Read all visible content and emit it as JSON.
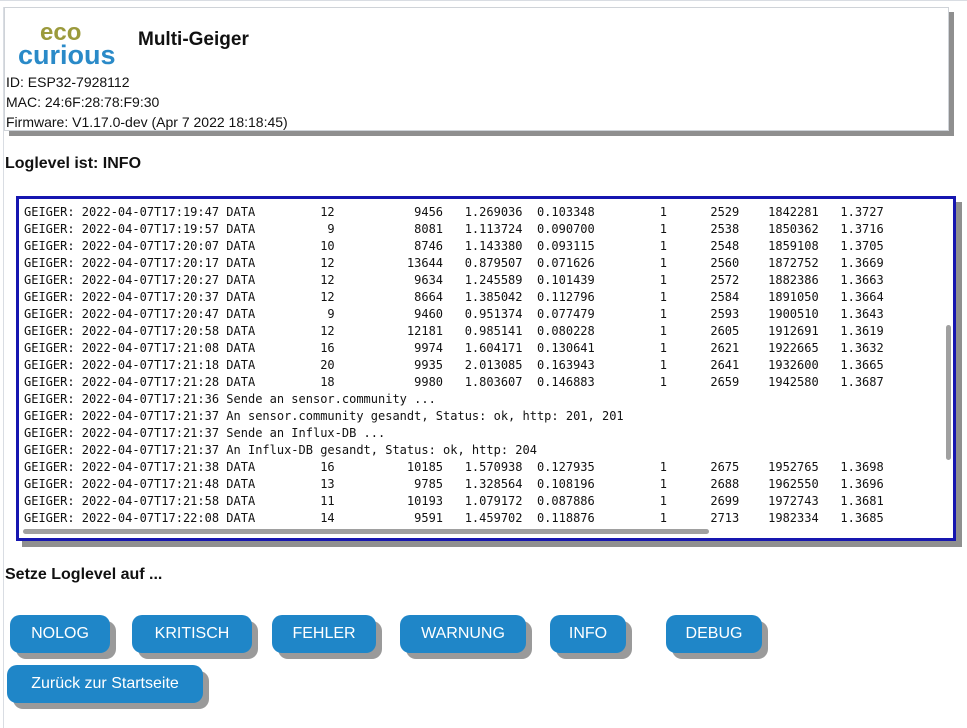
{
  "header": {
    "logo_top": "eco",
    "logo_bottom": "curious",
    "title": "Multi-Geiger",
    "id_line": "ID: ESP32-7928112",
    "mac_line": "MAC: 24:6F:28:78:F9:30",
    "firmware_line": "Firmware: V1.17.0-dev (Apr 7 2022 18:18:45)"
  },
  "loglevel_text": "Loglevel ist: INFO",
  "log": [
    "GEIGER: 2022-04-07T17:19:47 DATA         12           9456   1.269036  0.103348         1      2529    1842281   1.3727",
    "GEIGER: 2022-04-07T17:19:57 DATA          9           8081   1.113724  0.090700         1      2538    1850362   1.3716",
    "GEIGER: 2022-04-07T17:20:07 DATA         10           8746   1.143380  0.093115         1      2548    1859108   1.3705",
    "GEIGER: 2022-04-07T17:20:17 DATA         12          13644   0.879507  0.071626         1      2560    1872752   1.3669",
    "GEIGER: 2022-04-07T17:20:27 DATA         12           9634   1.245589  0.101439         1      2572    1882386   1.3663",
    "GEIGER: 2022-04-07T17:20:37 DATA         12           8664   1.385042  0.112796         1      2584    1891050   1.3664",
    "GEIGER: 2022-04-07T17:20:47 DATA          9           9460   0.951374  0.077479         1      2593    1900510   1.3643",
    "GEIGER: 2022-04-07T17:20:58 DATA         12          12181   0.985141  0.080228         1      2605    1912691   1.3619",
    "GEIGER: 2022-04-07T17:21:08 DATA         16           9974   1.604171  0.130641         1      2621    1922665   1.3632",
    "GEIGER: 2022-04-07T17:21:18 DATA         20           9935   2.013085  0.163943         1      2641    1932600   1.3665",
    "GEIGER: 2022-04-07T17:21:28 DATA         18           9980   1.803607  0.146883         1      2659    1942580   1.3687",
    "GEIGER: 2022-04-07T17:21:36 Sende an sensor.community ...",
    "GEIGER: 2022-04-07T17:21:37 An sensor.community gesandt, Status: ok, http: 201, 201",
    "GEIGER: 2022-04-07T17:21:37 Sende an Influx-DB ...",
    "GEIGER: 2022-04-07T17:21:37 An Influx-DB gesandt, Status: ok, http: 204",
    "GEIGER: 2022-04-07T17:21:38 DATA         16          10185   1.570938  0.127935         1      2675    1952765   1.3698",
    "GEIGER: 2022-04-07T17:21:48 DATA         13           9785   1.328564  0.108196         1      2688    1962550   1.3696",
    "GEIGER: 2022-04-07T17:21:58 DATA         11          10193   1.079172  0.087886         1      2699    1972743   1.3681",
    "GEIGER: 2022-04-07T17:22:08 DATA         14           9591   1.459702  0.118876         1      2713    1982334   1.3685"
  ],
  "setze_text": "Setze Loglevel auf ...",
  "buttons": {
    "nolog": "NOLOG",
    "kritisch": "KRITISCH",
    "fehler": "FEHLER",
    "warnung": "WARNUNG",
    "info": "INFO",
    "debug": "DEBUG",
    "back": "Zurück zur Startseite"
  },
  "colors": {
    "button": "#1f86c8",
    "log_border": "#1616b0",
    "logo_eco": "#9b9a3c",
    "logo_curious": "#2a8ac8"
  }
}
